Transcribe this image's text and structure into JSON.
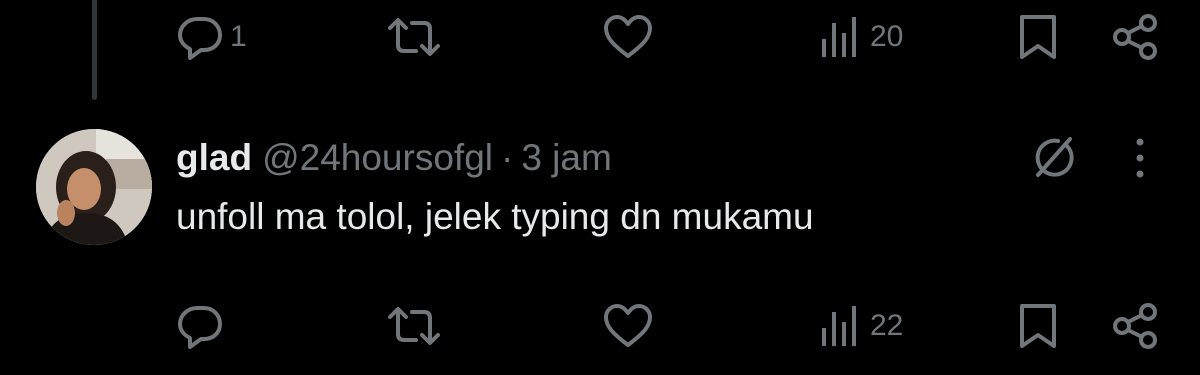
{
  "top_actions": {
    "reply_count": "1",
    "views_count": "20"
  },
  "tweet": {
    "display_name": "glad",
    "handle": "@24hoursofgl",
    "separator": "·",
    "timestamp": "3 jam",
    "text": "unfoll ma tolol, jelek typing dn mukamu",
    "avatar_icon": "profile-photo",
    "actions": {
      "reply_count": "",
      "views_count": "22"
    }
  },
  "icons": {
    "reply": "reply-icon",
    "repost": "repost-icon",
    "like": "heart-icon",
    "views": "views-icon",
    "bookmark": "bookmark-icon",
    "share": "share-icon",
    "grok": "grok-icon",
    "more": "more-icon"
  },
  "colors": {
    "background": "#000000",
    "text": "#e7e9ea",
    "muted": "#71767b",
    "thread_line": "#333639"
  }
}
